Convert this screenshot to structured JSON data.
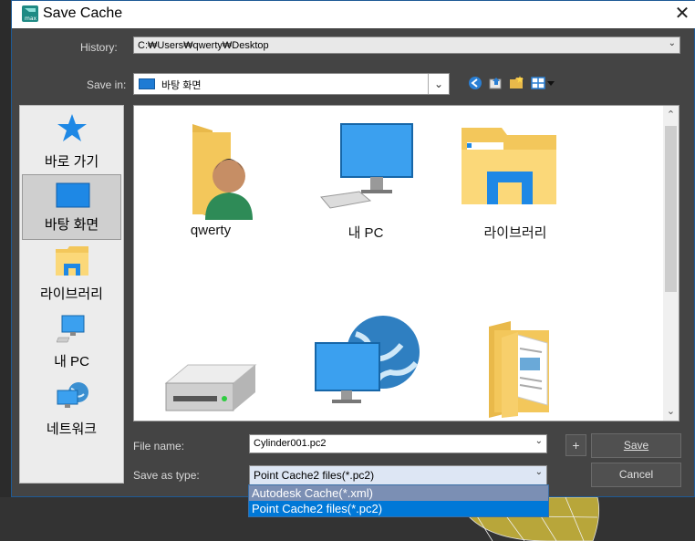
{
  "dialog": {
    "title": "Save Cache",
    "close_glyph": "✕"
  },
  "history": {
    "label": "History:",
    "value": "C:₩Users₩qwerty₩Desktop"
  },
  "save_in": {
    "label": "Save in:",
    "value": "바탕 화면"
  },
  "places": [
    {
      "label": "바로 가기",
      "icon": "quick-access-star-icon"
    },
    {
      "label": "바탕 화면",
      "icon": "desktop-icon"
    },
    {
      "label": "라이브러리",
      "icon": "libraries-icon"
    },
    {
      "label": "내 PC",
      "icon": "this-pc-icon"
    },
    {
      "label": "네트워크",
      "icon": "network-icon"
    }
  ],
  "files": [
    {
      "label": "qwerty",
      "icon": "user-folder-icon"
    },
    {
      "label": "내 PC",
      "icon": "this-pc-icon"
    },
    {
      "label": "라이브러리",
      "icon": "libraries-icon"
    },
    {
      "label": "",
      "icon": "drive-icon"
    },
    {
      "label": "",
      "icon": "network-icon"
    },
    {
      "label": "",
      "icon": "folder-documents-icon"
    }
  ],
  "file_name": {
    "label": "File name:",
    "value": "Cylinder001.pc2"
  },
  "save_as_type": {
    "label": "Save as type:",
    "value": "Point Cache2 files(*.pc2)",
    "options": [
      "Autodesk Cache(*.xml)",
      "Point Cache2 files(*.pc2)"
    ]
  },
  "buttons": {
    "plus": "+",
    "save": "Save",
    "cancel": "Cancel"
  },
  "colors": {
    "accent": "#0078d7",
    "dialog_bg": "#444444",
    "app_icon": "#2a9d8f"
  }
}
